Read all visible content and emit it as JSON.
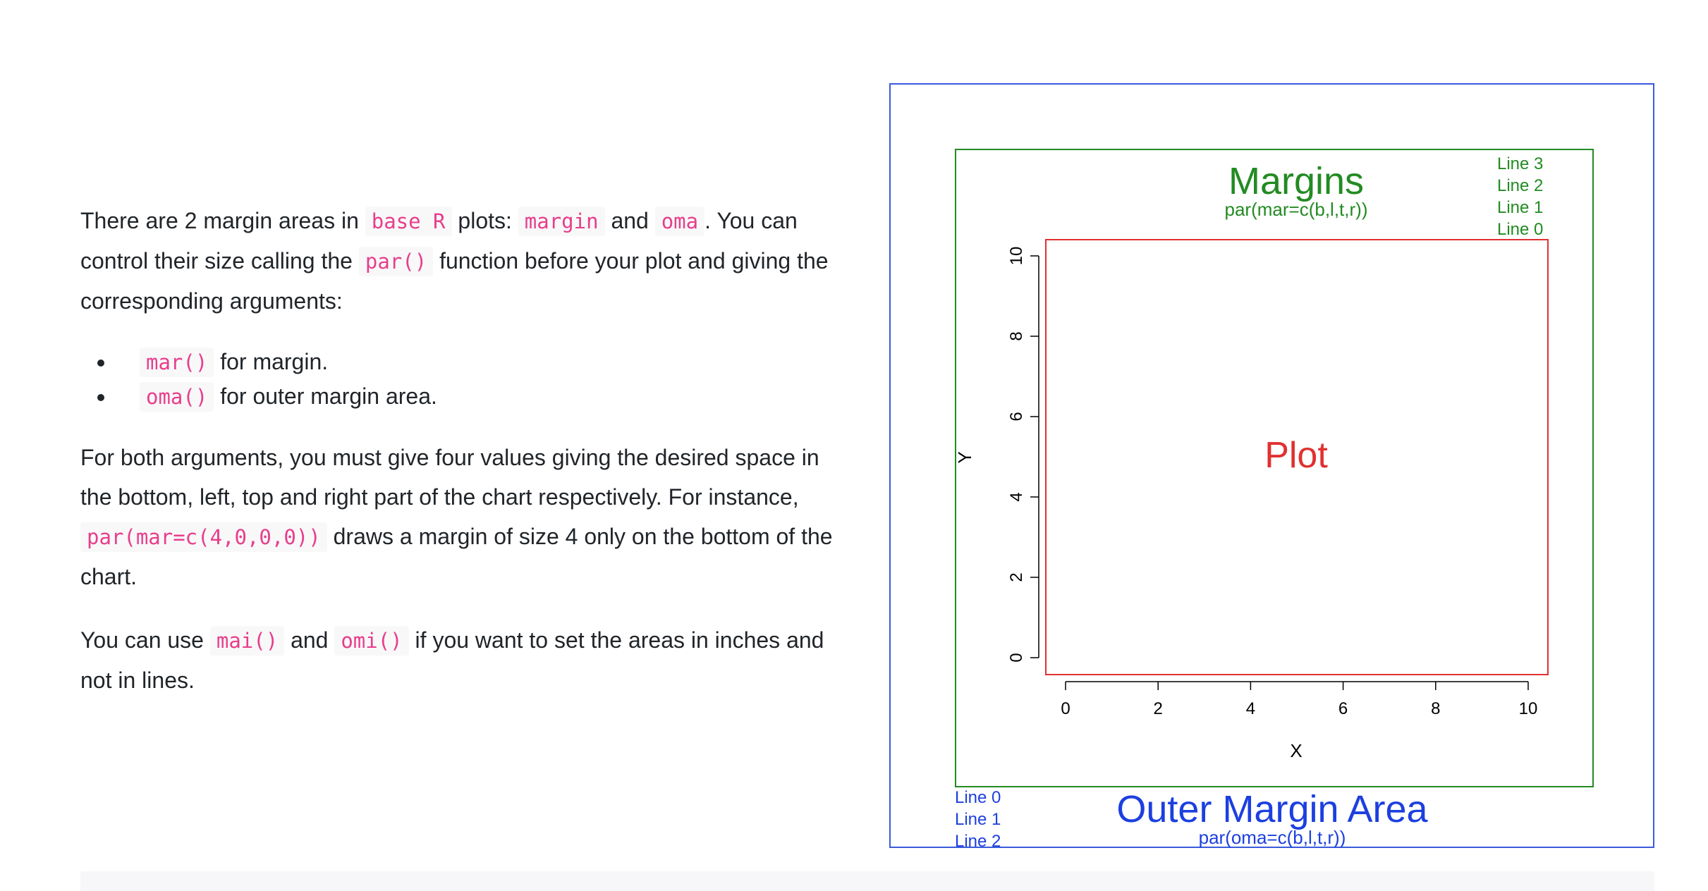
{
  "article": {
    "p1": {
      "t1": "There are 2 margin areas in ",
      "c1": "base R",
      "t2": " plots: ",
      "c2": "margin",
      "t3": " and ",
      "c3": "oma",
      "t4": ". You can control their size calling the ",
      "c4": "par()",
      "t5": " function before your plot and giving the corresponding arguments:"
    },
    "list": [
      {
        "code": "mar()",
        "text": " for margin."
      },
      {
        "code": "oma()",
        "text": " for outer margin area."
      }
    ],
    "p2": {
      "t1": "For both arguments, you must give four values giving the desired space in the bottom, left, top and right part of the chart respectively. For instance, ",
      "c1": "par(mar=c(4,0,0,0))",
      "t2": " draws a margin of size 4 only on the bottom of the chart."
    },
    "p3": {
      "t1": "You can use ",
      "c1": "mai()",
      "t2": " and ",
      "c2": "omi()",
      "t3": " if you want to set the areas in inches and not in lines."
    }
  },
  "figure": {
    "margins_title": "Margins",
    "margins_code": "par(mar=c(b,l,t,r))",
    "plot_label": "Plot",
    "oma_title": "Outer Margin Area",
    "oma_code": "par(oma=c(b,l,t,r))",
    "margin_lines": [
      "Line 3",
      "Line 2",
      "Line 1",
      "Line 0"
    ],
    "oma_lines": [
      "Line 0",
      "Line 1",
      "Line 2"
    ],
    "colors": {
      "outer_border": "#3b5bdb",
      "margin": "#228b22",
      "plot": "#e03131",
      "oma_text": "#1c3fe0"
    }
  },
  "chart_data": {
    "type": "scatter",
    "x": [],
    "y": [],
    "xlabel": "X",
    "ylabel": "Y",
    "xlim": [
      0,
      10
    ],
    "ylim": [
      0,
      10
    ],
    "xticks": [
      "0",
      "2",
      "4",
      "6",
      "8",
      "10"
    ],
    "yticks": [
      "0",
      "2",
      "4",
      "6",
      "8",
      "10"
    ],
    "grid": false
  }
}
